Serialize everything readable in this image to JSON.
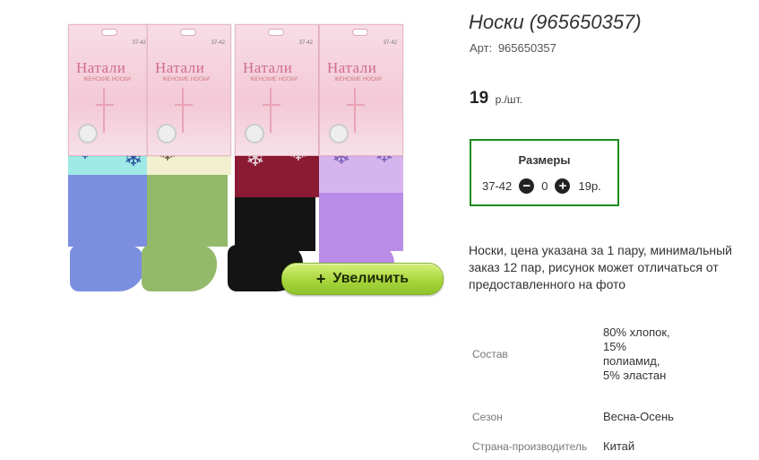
{
  "product": {
    "title": "Носки (965650357)",
    "article_label": "Арт:",
    "article_value": "965650357",
    "price_value": "19",
    "price_unit": "р./шт.",
    "zoom_button_label": "Увеличить",
    "zoom_button_icon": "+",
    "image_card_brand": "Натали",
    "image_card_sub": "ЖЕНСКИЕ НОСКИ",
    "image_card_size": "37-42"
  },
  "sizes": {
    "header": "Размеры",
    "items": [
      {
        "size": "37-42",
        "quantity": "0",
        "price": "19р."
      }
    ],
    "minus_symbol": "−",
    "plus_symbol": "+"
  },
  "description": "Носки, цена указана за 1 пару, минимальный заказ 12 пар, рисунок может отличаться от предоставленного на фото",
  "specs": [
    {
      "label": "Состав",
      "value": "80% хлопок, 15% полиамид, 5% эластан"
    },
    {
      "label": "Сезон",
      "value": "Весна-Осень"
    },
    {
      "label": "Страна-производитель",
      "value": "Китай"
    }
  ],
  "colors": {
    "accent_green_border": "#1f8a1f",
    "zoom_button_green": "#a8d63c",
    "sock_colors": [
      "#8fe3e0",
      "#a7c977",
      "#8a1530",
      "#c9a6ef"
    ]
  }
}
